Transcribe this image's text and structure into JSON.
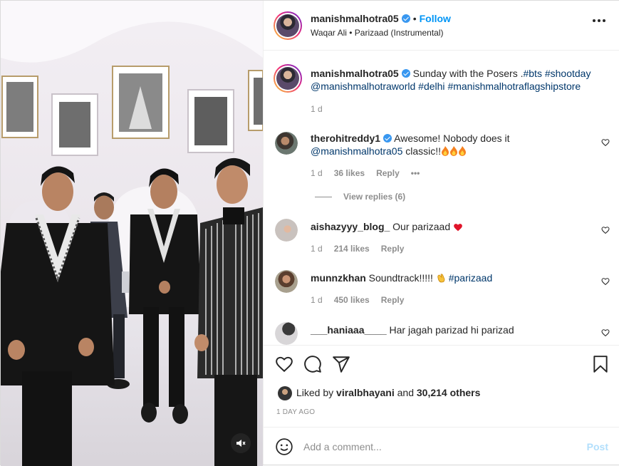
{
  "post": {
    "author": "manishmalhotra05",
    "follow_label": "Follow",
    "separator": "•",
    "audio_artist": "Waqar Ali",
    "audio_dot": "•",
    "audio_track": "Parizaad (Instrumental)",
    "more_icon": "more-horizontal-icon"
  },
  "caption": {
    "author": "manishmalhotra05",
    "text_plain": "Sunday with the Posers .",
    "tags": [
      "#bts",
      "#shootday",
      "@manishmalhotraworld",
      "#delhi",
      "#manishmalhotraflagshipstore"
    ],
    "time": "1 d"
  },
  "comments": [
    {
      "author": "therohitreddy1",
      "verified": true,
      "text_before": "Awesome! Nobody does it",
      "mention": "@manishmalhotra05",
      "text_after": "classic!!",
      "emoji": "fire-emoji x3",
      "time": "1 d",
      "likes": "36 likes",
      "reply": "Reply",
      "view_replies": "View replies (6)"
    },
    {
      "author": "aishazyyy_blog_",
      "text": "Our parizaad",
      "emoji": "red-heart-emoji",
      "time": "1 d",
      "likes": "214 likes",
      "reply": "Reply"
    },
    {
      "author": "munnzkhan",
      "text": "Soundtrack!!!!!",
      "emoji": "clapping-hand-emoji",
      "tag": "#parizaad",
      "time": "1 d",
      "likes": "450 likes",
      "reply": "Reply"
    },
    {
      "author": "___haniaaa____",
      "text": "Har jagah parizad hi parizad"
    }
  ],
  "likes": {
    "prefix": "Liked by",
    "user": "viralbhayani",
    "and": "and",
    "others": "30,214 others"
  },
  "date": "1 DAY AGO",
  "add_comment": {
    "placeholder": "Add a comment...",
    "post_label": "Post"
  },
  "colors": {
    "link": "#00376b",
    "follow": "#0095f6",
    "verified": "#3897f0",
    "muted": "#8e8e8e",
    "post_disabled": "#b2dffc"
  }
}
